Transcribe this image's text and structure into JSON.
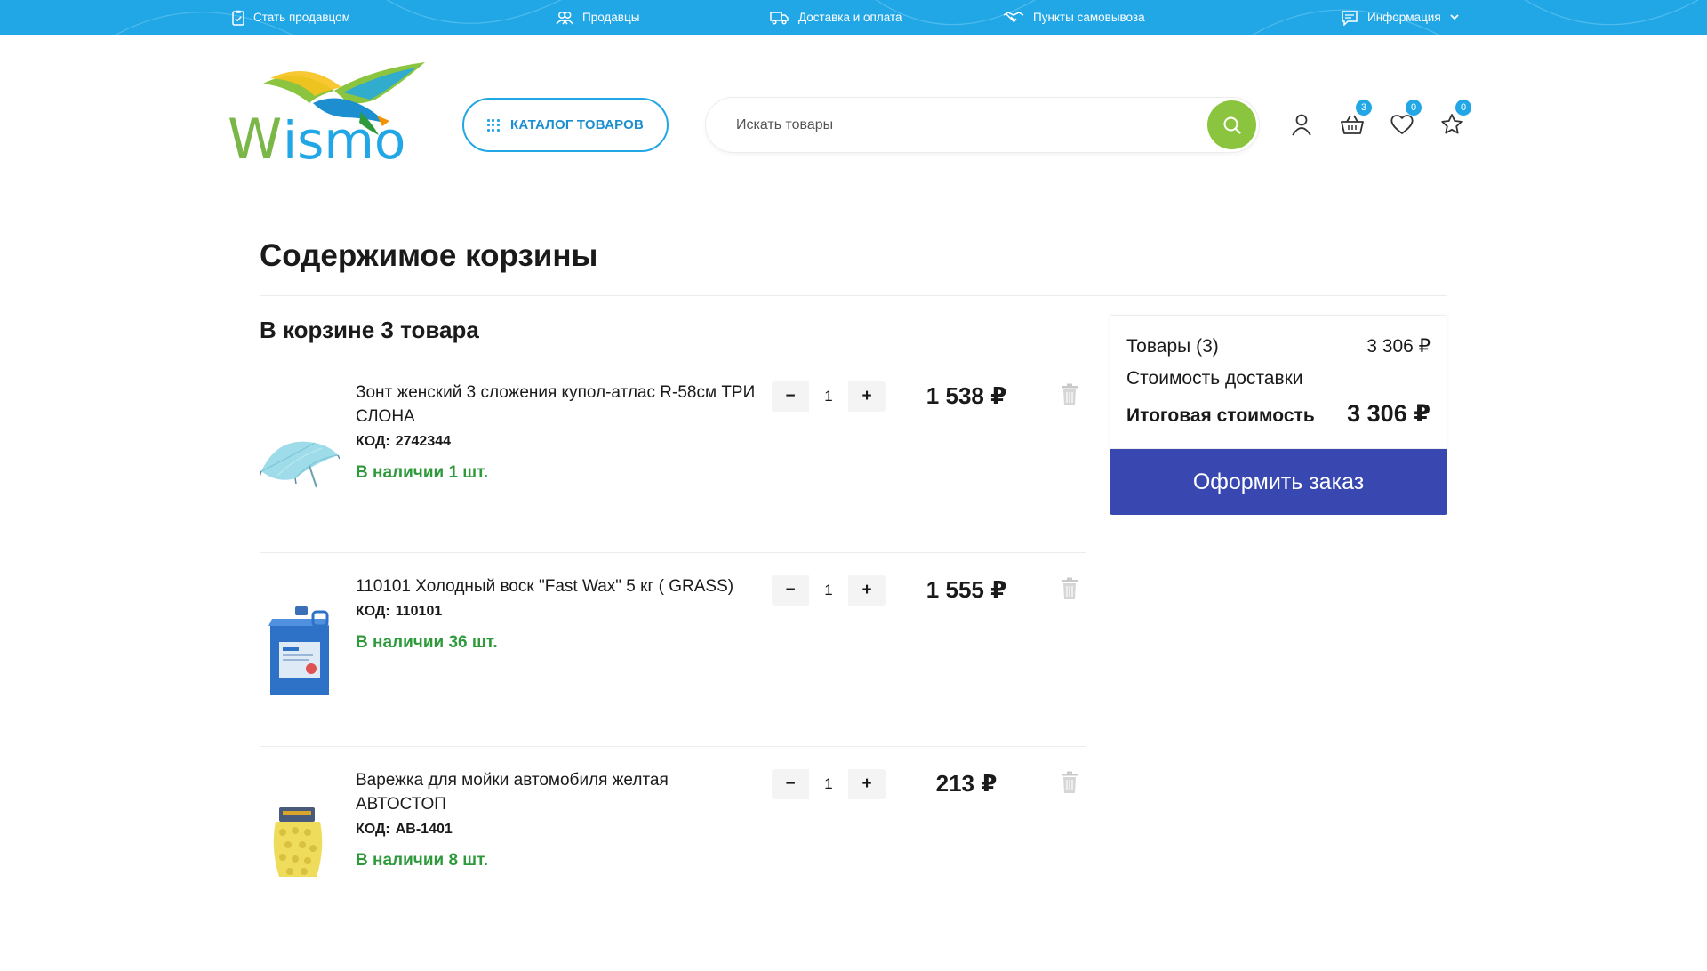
{
  "topbar": {
    "items": [
      {
        "label": "Стать продавцом",
        "icon": "clipboard-check-icon"
      },
      {
        "label": "Продавцы",
        "icon": "users-icon"
      },
      {
        "label": "Доставка и оплата",
        "icon": "truck-icon"
      },
      {
        "label": "Пункты самовывоза",
        "icon": "handshake-icon"
      },
      {
        "label": "Информация",
        "icon": "chat-icon"
      }
    ]
  },
  "header": {
    "logo_text": "Wismo",
    "catalog_label": "КАТАЛОГ ТОВАРОВ",
    "search_placeholder": "Искать товары",
    "badges": {
      "cart": "3",
      "favorites": "0",
      "compare": "0"
    }
  },
  "cart": {
    "title": "Содержимое корзины",
    "count_label": "В корзине 3 товара",
    "code_label": "КОД:",
    "items": [
      {
        "name": "Зонт женский 3 сложения купол-атлас R-58см ТРИ СЛОНА",
        "code": "2742344",
        "stock": "В наличии 1 шт.",
        "qty": "1",
        "price": "1 538 ₽",
        "image": "umbrella-image"
      },
      {
        "name": "110101 Холодный воск \"Fast Wax\" 5 кг ( GRASS)",
        "code": "110101",
        "stock": "В наличии 36 шт.",
        "qty": "1",
        "price": "1 555 ₽",
        "image": "canister-image"
      },
      {
        "name": "Варежка для мойки автомобиля желтая АВТОСТОП",
        "code": "AB-1401",
        "stock": "В наличии 8 шт.",
        "qty": "1",
        "price": "213 ₽",
        "image": "wash-mitt-image"
      }
    ]
  },
  "summary": {
    "goods_label": "Товары (3)",
    "goods_value": "3 306 ₽",
    "delivery_label": "Стоимость доставки",
    "total_label": "Итоговая стоимость",
    "total_value": "3 306 ₽",
    "checkout_label": "Оформить заказ"
  },
  "colors": {
    "topbar": "#22a7e6",
    "search_button": "#8bc53f",
    "stock_text": "#2f9a3c",
    "checkout": "#3848b0"
  }
}
